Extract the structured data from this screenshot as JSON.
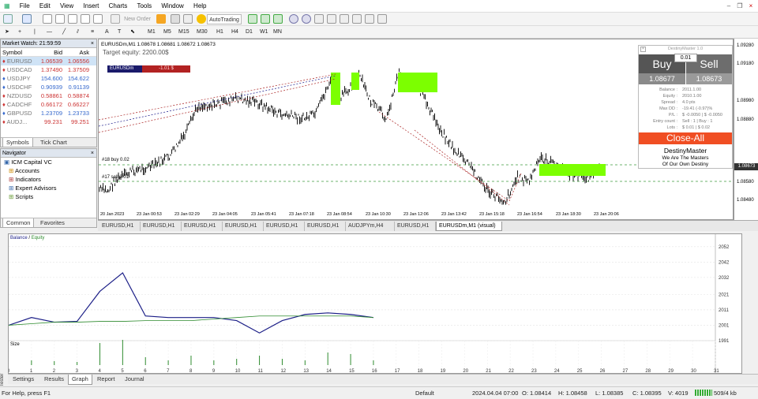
{
  "menu": [
    "File",
    "Edit",
    "View",
    "Insert",
    "Charts",
    "Tools",
    "Window",
    "Help"
  ],
  "toolbar": {
    "new_order": "New Order",
    "autotrading": "AutoTrading"
  },
  "timeframes": [
    "M1",
    "M5",
    "M15",
    "M30",
    "H1",
    "H4",
    "D1",
    "W1",
    "MN"
  ],
  "market_watch": {
    "title": "Market Watch: 21:59:59",
    "cols": [
      "Symbol",
      "Bid",
      "Ask"
    ],
    "rows": [
      [
        "EURUSD",
        "1.06539",
        "1.06556"
      ],
      [
        "USDCAD",
        "1.37490",
        "1.37509"
      ],
      [
        "USDJPY",
        "154.600",
        "154.622"
      ],
      [
        "USDCHF",
        "0.90939",
        "0.91139"
      ],
      [
        "NZDUSD",
        "0.58861",
        "0.58874"
      ],
      [
        "CADCHF",
        "0.66172",
        "0.66227"
      ],
      [
        "GBPUSD",
        "1.23709",
        "1.23733"
      ],
      [
        "AUDJ...",
        "99.231",
        "99.251"
      ]
    ],
    "tabs": [
      "Symbols",
      "Tick Chart"
    ]
  },
  "navigator": {
    "title": "Navigator",
    "items": [
      "ICM Capital VC",
      "Accounts",
      "Indicators",
      "Expert Advisors",
      "Scripts"
    ],
    "tabs": [
      "Common",
      "Favorites"
    ]
  },
  "chart": {
    "header": "EURUSDm,M1  1.08678 1.08681 1.08672 1.08673",
    "target": "Target equity: 2200.00$",
    "badge_symbol": "EURUSDm",
    "badge_value": "-1.01 $",
    "buy_line": "#18 buy 0.02",
    "sell_line": "#17 sell 0.01",
    "price_ticks": [
      "1.09280",
      "1.09180",
      "1.08980",
      "1.08880",
      "1.08780",
      "1.08580",
      "1.08480"
    ],
    "current_price": "1.08673",
    "time_ticks": [
      "20 Jan 2023",
      "23 Jan 00:53",
      "23 Jan 02:29",
      "23 Jan 04:05",
      "23 Jan 05:41",
      "23 Jan 07:18",
      "23 Jan 08:54",
      "23 Jan 10:30",
      "23 Jan 12:06",
      "23 Jan 13:42",
      "23 Jan 15:18",
      "23 Jan 16:54",
      "23 Jan 18:30",
      "23 Jan 20:06"
    ]
  },
  "panel": {
    "title": "DestinyMaster 1.0",
    "buy": "Buy",
    "sell": "Sell",
    "lot": "0.01",
    "buy_price": "1.08677",
    "sell_price": "1.08673",
    "rows": [
      [
        "Balance :",
        "2011.1.00"
      ],
      [
        "Equity :",
        "2010.1.00"
      ],
      [
        "Spread :",
        "4.0 pts"
      ],
      [
        "Max DD :",
        "-19.41 (-0.97)%"
      ],
      [
        "P/L :",
        "$ -0.0050 | $ -0.0050"
      ],
      [
        "Entry count :",
        "Sell : 1 | Buy : 1"
      ],
      [
        "Lots :",
        "$ 0.01 | $ 0.02"
      ]
    ],
    "close_all": "Close-All",
    "brand": "DestinyMaster",
    "slogan1": "We Are The Masters",
    "slogan2": "Of Our Own Destiny"
  },
  "chart_tabs": [
    "EURUSD,H1",
    "EURUSD,H1",
    "EURUSD,H1",
    "EURUSD,H1",
    "EURUSD,H1",
    "EURUSD,H1",
    "AUDJPYm,H4",
    "EURUSD,H1",
    "EURUSDm,M1 (visual)"
  ],
  "tester": {
    "legend_balance": "Balance",
    "legend_sep": " / ",
    "legend_equity": "Equity",
    "size_label": "Size",
    "y_ticks": [
      "2052",
      "2042",
      "2032",
      "2021",
      "2011",
      "2001",
      "1991"
    ],
    "x_ticks": [
      "0",
      "1",
      "2",
      "3",
      "4",
      "5",
      "6",
      "7",
      "8",
      "9",
      "10",
      "11",
      "12",
      "13",
      "14",
      "15",
      "16",
      "17",
      "18",
      "19",
      "20",
      "21",
      "22",
      "23",
      "24",
      "25",
      "26",
      "27",
      "28",
      "29",
      "30",
      "31"
    ],
    "tabs": [
      "Settings",
      "Results",
      "Graph",
      "Report",
      "Journal"
    ],
    "side_label": "Tester"
  },
  "tester_chart": {
    "type": "line",
    "x": [
      0,
      1,
      2,
      3,
      4,
      5,
      6,
      7,
      8,
      9,
      10,
      11,
      12,
      13,
      14,
      15,
      16
    ],
    "series": [
      {
        "name": "Balance",
        "values": [
          2001,
          2006,
          2003,
          2003.5,
          2023,
          2035,
          2007,
          2006,
          2006,
          2006,
          2004,
          1996,
          2004,
          2008,
          2009,
          2008,
          2006
        ]
      },
      {
        "name": "Equity",
        "values": [
          2001,
          2002,
          2003,
          2003,
          2003.5,
          2003.5,
          2004,
          2004,
          2004,
          2005,
          2006,
          2007,
          2007,
          2007,
          2007,
          2007,
          2006
        ]
      }
    ],
    "ylim": [
      1991,
      2057
    ]
  },
  "status": {
    "help": "For Help, press F1",
    "profile": "Default",
    "time": "2024.04.04 07:00",
    "open": "O: 1.08414",
    "high": "H: 1.08458",
    "low": "L: 1.08385",
    "close": "C: 1.08395",
    "vol": "V: 4019",
    "traffic": "509/4 kb"
  },
  "colors": {
    "buy": "#555555",
    "sell": "#6d6d6d",
    "close": "#f04e23",
    "box": "#7cff00",
    "bal": "#1b1e87",
    "eq": "#2e8b2e"
  }
}
